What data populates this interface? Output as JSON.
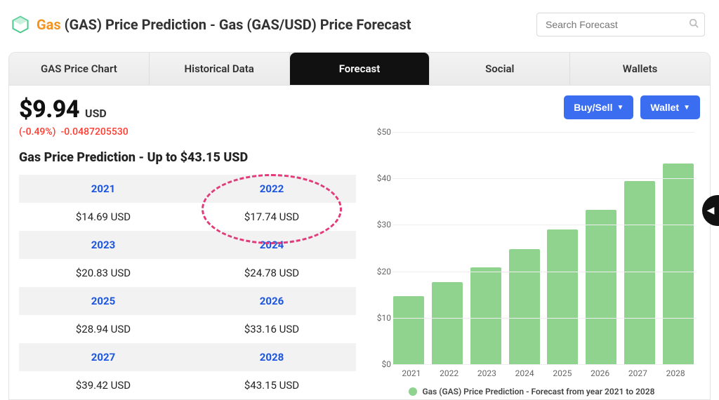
{
  "header": {
    "coin_name": "Gas",
    "title_rest": " (GAS) Price Prediction - Gas (GAS/USD) Price Forecast",
    "search_placeholder": "Search Forecast"
  },
  "tabs": [
    {
      "id": "chart",
      "label": "GAS Price Chart",
      "active": false
    },
    {
      "id": "history",
      "label": "Historical Data",
      "active": false
    },
    {
      "id": "forecast",
      "label": "Forecast",
      "active": true
    },
    {
      "id": "social",
      "label": "Social",
      "active": false
    },
    {
      "id": "wallets",
      "label": "Wallets",
      "active": false
    }
  ],
  "price": {
    "amount": "$9.94",
    "currency": "USD",
    "change_pct": "(-0.49%)",
    "change_abs": "-0.0487205530"
  },
  "prediction_title": "Gas Price Prediction - Up to $43.15 USD",
  "prediction_table": {
    "rows": [
      {
        "y1": "2021",
        "v1": "$14.69 USD",
        "y2": "2022",
        "v2": "$17.74 USD",
        "circle": "right"
      },
      {
        "y1": "2023",
        "v1": "$20.83 USD",
        "y2": "2024",
        "v2": "$24.78 USD"
      },
      {
        "y1": "2025",
        "v1": "$28.94 USD",
        "y2": "2026",
        "v2": "$33.16 USD"
      },
      {
        "y1": "2027",
        "v1": "$39.42 USD",
        "y2": "2028",
        "v2": "$43.15 USD"
      }
    ]
  },
  "actions": {
    "buy_sell": "Buy/Sell",
    "wallet": "Wallet"
  },
  "chart_data": {
    "type": "bar",
    "categories": [
      "2021",
      "2022",
      "2023",
      "2024",
      "2025",
      "2026",
      "2027",
      "2028"
    ],
    "values": [
      14.69,
      17.74,
      20.83,
      24.78,
      28.94,
      33.16,
      39.42,
      43.15
    ],
    "title": "",
    "xlabel": "",
    "ylabel": "",
    "ylim": [
      0,
      50
    ],
    "y_ticks": [
      "$50",
      "$40",
      "$30",
      "$20",
      "$10",
      "$0"
    ],
    "legend": "Gas (GAS) Price Prediction - Forecast from year 2021 to 2028",
    "bar_color": "#8fd38f"
  }
}
